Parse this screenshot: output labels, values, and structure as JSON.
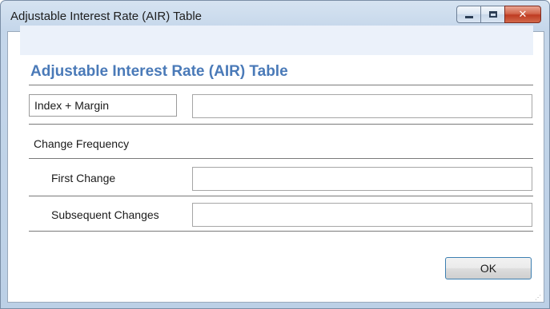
{
  "window": {
    "title": "Adjustable Interest Rate (AIR) Table",
    "controls": {
      "minimize": "minimize-icon",
      "maximize": "maximize-icon",
      "close": "close-icon"
    },
    "close_glyph": "✕"
  },
  "form": {
    "heading": "Adjustable Interest Rate (AIR) Table",
    "index_margin": {
      "label": "Index + Margin",
      "value": ""
    },
    "change_frequency": {
      "label": "Change Frequency"
    },
    "first_change": {
      "label": "First Change",
      "value": ""
    },
    "subsequent_changes": {
      "label": "Subsequent Changes",
      "value": ""
    }
  },
  "buttons": {
    "ok_label": "OK"
  },
  "colors": {
    "heading": "#4a7ab8",
    "header_band": "#ebf1fa",
    "close_button": "#c94a32"
  }
}
